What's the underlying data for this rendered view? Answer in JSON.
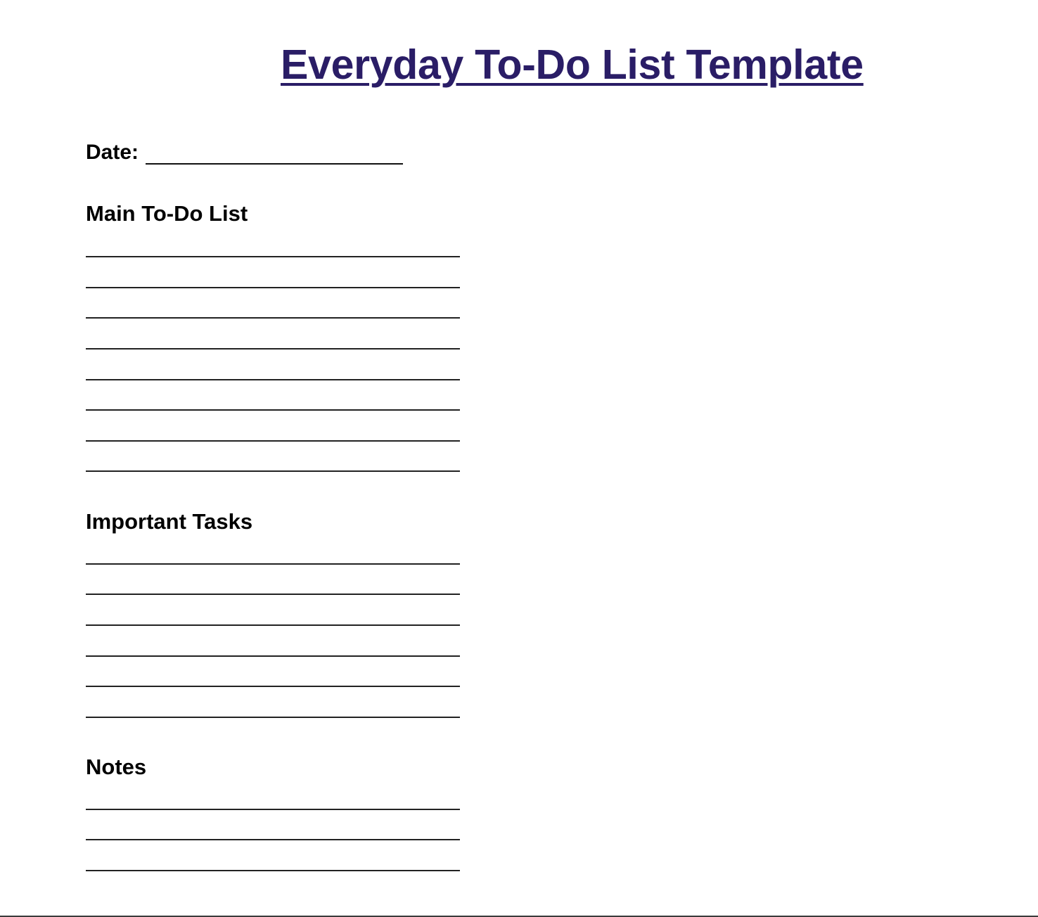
{
  "document": {
    "title": "Everyday To-Do List Template",
    "title_color": "#2a1d66",
    "date_label": "Date:",
    "date_value": "",
    "sections": [
      {
        "heading": "Main To-Do List",
        "line_count": 8
      },
      {
        "heading": "Important Tasks",
        "line_count": 6
      },
      {
        "heading": "Notes",
        "line_count": 3
      }
    ]
  }
}
